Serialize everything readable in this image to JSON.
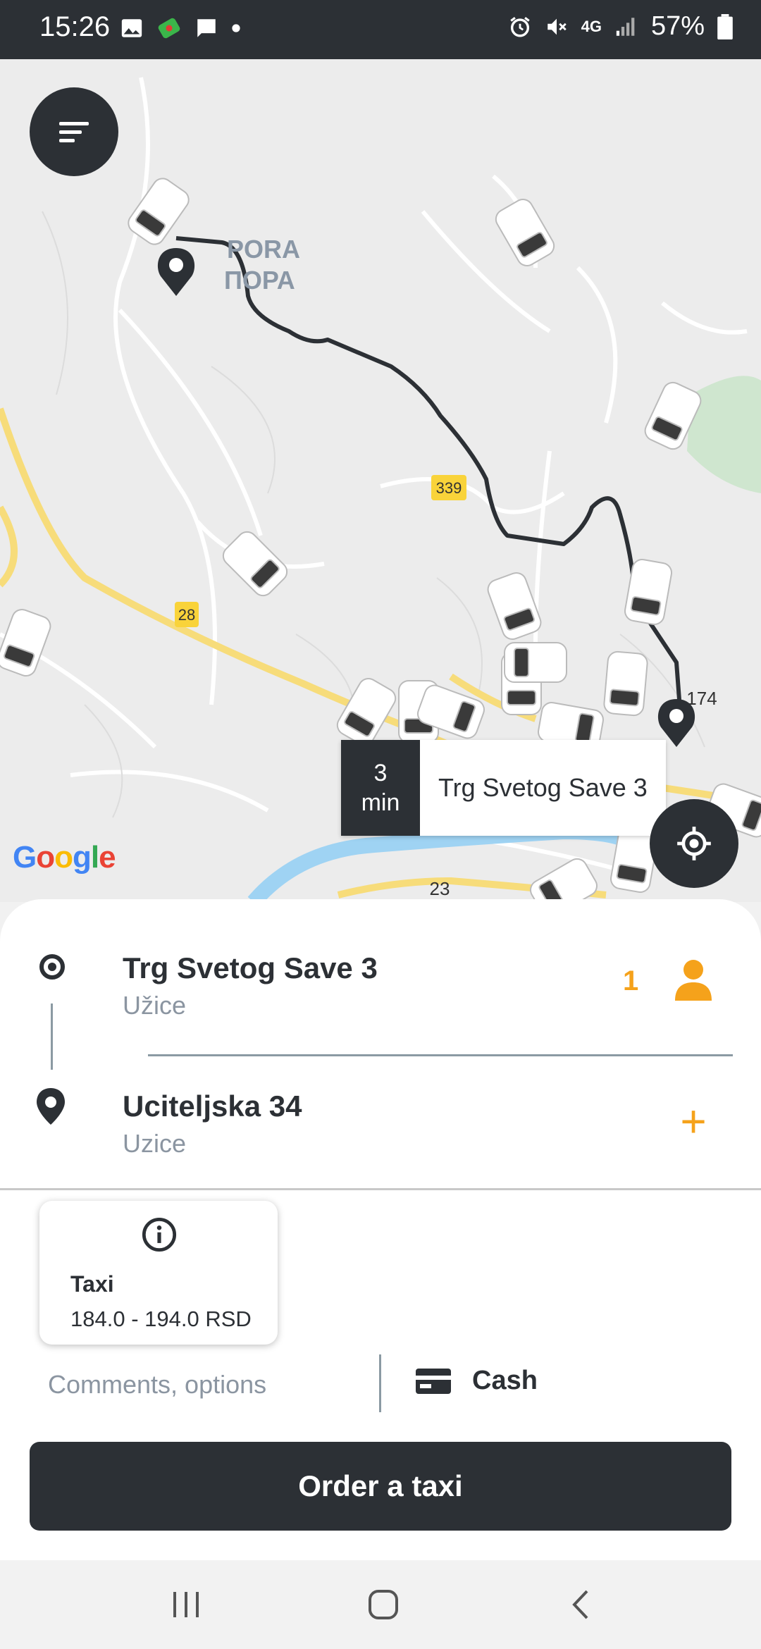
{
  "status_bar": {
    "time": "15:26",
    "network": "4G",
    "battery": "57%"
  },
  "map": {
    "place_label_latin": "PORA",
    "place_label_cyrillic": "ПОРА",
    "road_labels": [
      "339",
      "28",
      "23",
      "174"
    ],
    "eta_value": "3",
    "eta_unit": "min",
    "eta_address": "Trg Svetog Save 3",
    "attribution": "Google"
  },
  "route": {
    "pickup": {
      "title": "Trg Svetog Save 3",
      "city": "Užice"
    },
    "destination": {
      "title": "Uciteljska 34",
      "city": "Uzice"
    },
    "passengers": "1",
    "add_stop": "+"
  },
  "tariff": {
    "name": "Taxi",
    "price": "184.0 - 194.0 RSD"
  },
  "options": {
    "comments_placeholder": "Comments, options",
    "payment_method": "Cash"
  },
  "order_button": "Order a taxi",
  "colors": {
    "accent": "#f5a21b",
    "dark": "#2c3035",
    "route_line": "#2c3035",
    "muted_text": "#8b95a1"
  },
  "icons": [
    "menu-icon",
    "locate-icon",
    "pin-icon",
    "origin-dot-icon",
    "person-icon",
    "info-icon",
    "card-icon",
    "recents-icon",
    "home-icon",
    "back-icon"
  ]
}
